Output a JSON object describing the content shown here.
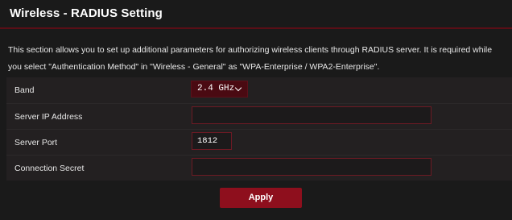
{
  "header": {
    "title": "Wireless - RADIUS Setting"
  },
  "description": {
    "line1": "This section allows you to set up additional parameters for authorizing wireless clients through RADIUS server. It is required while",
    "line2": "you select \"Authentication Method\" in \"Wireless - General\" as \"WPA-Enterprise / WPA2-Enterprise\"."
  },
  "form": {
    "band": {
      "label": "Band",
      "value": "2.4 GHz"
    },
    "server_ip": {
      "label": "Server IP Address",
      "value": ""
    },
    "server_port": {
      "label": "Server Port",
      "value": "1812"
    },
    "connection_secret": {
      "label": "Connection Secret",
      "value": ""
    }
  },
  "actions": {
    "apply_label": "Apply"
  },
  "colors": {
    "accent": "#8e0f1d",
    "background": "#1a1a1a",
    "field_border": "#6e1a24"
  },
  "icons": {
    "band_dropdown": "chevron-down-icon"
  }
}
